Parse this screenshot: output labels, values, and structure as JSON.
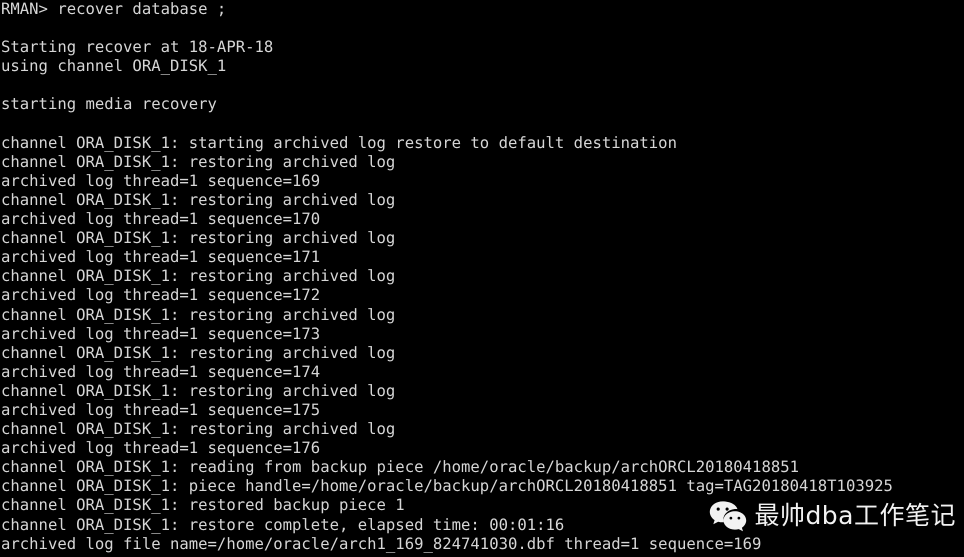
{
  "terminal": {
    "background_color": "#000000",
    "text_color": "#d6d6d6",
    "prompt": "RMAN>",
    "lines": [
      "RMAN> recover database ;",
      "",
      "Starting recover at 18-APR-18",
      "using channel ORA_DISK_1",
      "",
      "starting media recovery",
      "",
      "channel ORA_DISK_1: starting archived log restore to default destination",
      "channel ORA_DISK_1: restoring archived log",
      "archived log thread=1 sequence=169",
      "channel ORA_DISK_1: restoring archived log",
      "archived log thread=1 sequence=170",
      "channel ORA_DISK_1: restoring archived log",
      "archived log thread=1 sequence=171",
      "channel ORA_DISK_1: restoring archived log",
      "archived log thread=1 sequence=172",
      "channel ORA_DISK_1: restoring archived log",
      "archived log thread=1 sequence=173",
      "channel ORA_DISK_1: restoring archived log",
      "archived log thread=1 sequence=174",
      "channel ORA_DISK_1: restoring archived log",
      "archived log thread=1 sequence=175",
      "channel ORA_DISK_1: restoring archived log",
      "archived log thread=1 sequence=176",
      "channel ORA_DISK_1: reading from backup piece /home/oracle/backup/archORCL20180418851",
      "channel ORA_DISK_1: piece handle=/home/oracle/backup/archORCL20180418851 tag=TAG20180418T103925",
      "channel ORA_DISK_1: restored backup piece 1",
      "channel ORA_DISK_1: restore complete, elapsed time: 00:01:16",
      "archived log file name=/home/oracle/arch1_169_824741030.dbf thread=1 sequence=169"
    ]
  },
  "watermark": {
    "icon": "wechat-logo-icon",
    "label": "最帅dba工作笔记",
    "color": "#f2f2f2"
  }
}
